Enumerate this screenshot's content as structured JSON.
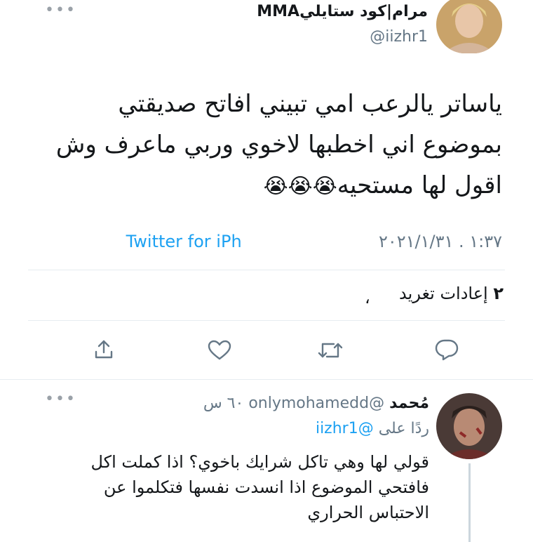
{
  "tweet": {
    "author_name": "مرام|كود ستايليMMA",
    "author_handle": "@iizhr1",
    "text_lines": [
      "ياساتر يالرعب امي تبيني افاتح صديقتي",
      "بموضوع اني اخطبها لاخوي وربي ماعرف وش",
      "اقول لها مستحيه"
    ],
    "emoji": "😭😭😭",
    "timestamp": "١:٣٧ . ٢٠٢١/١/٣١",
    "source": "Twitter for iPh",
    "retweets_count": "٢",
    "retweets_label": "إعادات تغريد"
  },
  "reply": {
    "author_name": "مُحمد",
    "author_handle": "@onlymohamedd",
    "time": "٦٠ س",
    "replying_to_label": "ردًا على",
    "replying_to_handle": "@iizhr1",
    "text_lines": [
      "قولي لها وهي تاكل شرايك باخوي؟ اذا كملت اكل",
      "فافتحي الموضوع اذا انسدت نفسها فتكلموا عن",
      "الاحتباس الحراري"
    ]
  },
  "colors": {
    "accent": "#1da1f2",
    "muted": "#657786",
    "divider": "#e6ecf0"
  },
  "icons": [
    "more-icon",
    "share-icon",
    "like-icon",
    "retweet-icon",
    "reply-icon"
  ]
}
